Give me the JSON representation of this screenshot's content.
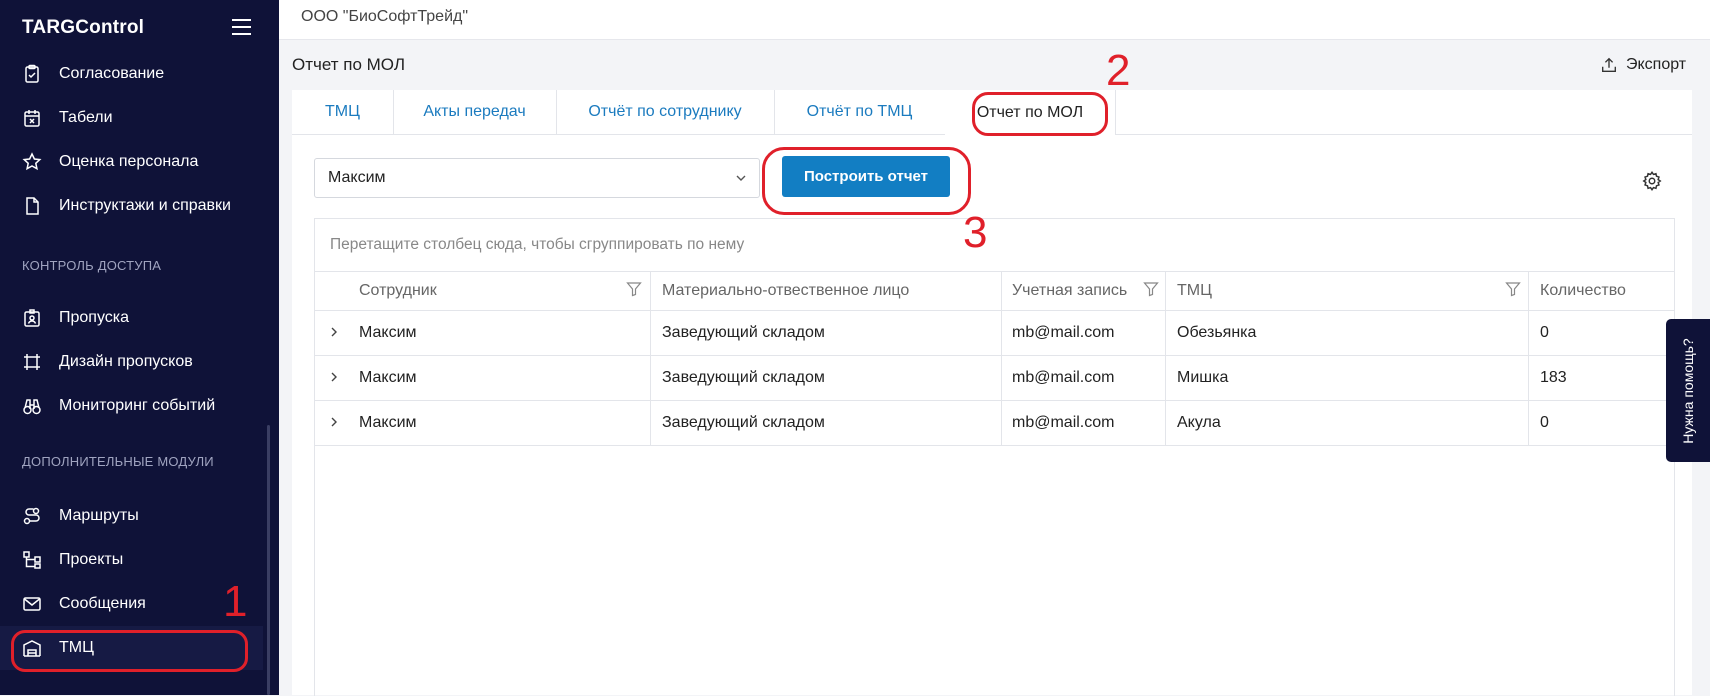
{
  "sidebar": {
    "logo": "TARGControl",
    "items_top": [
      {
        "label": "Согласование",
        "icon": "checklist-icon"
      },
      {
        "label": "Табели",
        "icon": "calendar-icon"
      },
      {
        "label": "Оценка персонала",
        "icon": "star-icon"
      },
      {
        "label": "Инструктажи и справки",
        "icon": "document-icon"
      }
    ],
    "section_access": "КОНТРОЛЬ ДОСТУПА",
    "items_access": [
      {
        "label": "Пропуска",
        "icon": "badge-icon"
      },
      {
        "label": "Дизайн пропусков",
        "icon": "design-icon"
      },
      {
        "label": "Мониторинг событий",
        "icon": "binoculars-icon"
      }
    ],
    "section_modules": "ДОПОЛНИТЕЛЬНЫЕ МОДУЛИ",
    "items_modules": [
      {
        "label": "Маршруты",
        "icon": "route-icon"
      },
      {
        "label": "Проекты",
        "icon": "project-icon"
      },
      {
        "label": "Сообщения",
        "icon": "mail-icon"
      },
      {
        "label": "ТМЦ",
        "icon": "warehouse-icon"
      }
    ]
  },
  "topbar": {
    "company": "ООО \"БиоСофтТрейд\""
  },
  "page": {
    "title": "Отчет по МОЛ",
    "export_label": "Экспорт"
  },
  "tabs": [
    "ТМЦ",
    "Акты передач",
    "Отчёт по сотруднику",
    "Отчёт по ТМЦ",
    "Отчет по МОЛ"
  ],
  "active_tab": "Отчет по МОЛ",
  "filter": {
    "employee_value": "Максим",
    "build_button": "Построить отчет"
  },
  "grid": {
    "group_panel_text": "Перетащите столбец сюда, чтобы сгруппировать по нему",
    "columns": [
      "Сотрудник",
      "Материально-отвественное лицо",
      "Учетная запись",
      "ТМЦ",
      "Количество"
    ],
    "rows": [
      [
        "Максим",
        "Заведующий складом",
        "mb@mail.com",
        "Обезьянка",
        "0"
      ],
      [
        "Максим",
        "Заведующий складом",
        "mb@mail.com",
        "Мишка",
        "183"
      ],
      [
        "Максим",
        "Заведующий складом",
        "mb@mail.com",
        "Акула",
        "0"
      ]
    ]
  },
  "help_tab": "Нужна помощь?",
  "annotations": {
    "marker_1": "1",
    "marker_2": "2",
    "marker_3": "3",
    "color": "#e0202a"
  },
  "colors": {
    "sidebar_bg": "#0f1238",
    "accent": "#127ec3",
    "tab_link": "#1b7bbf"
  }
}
